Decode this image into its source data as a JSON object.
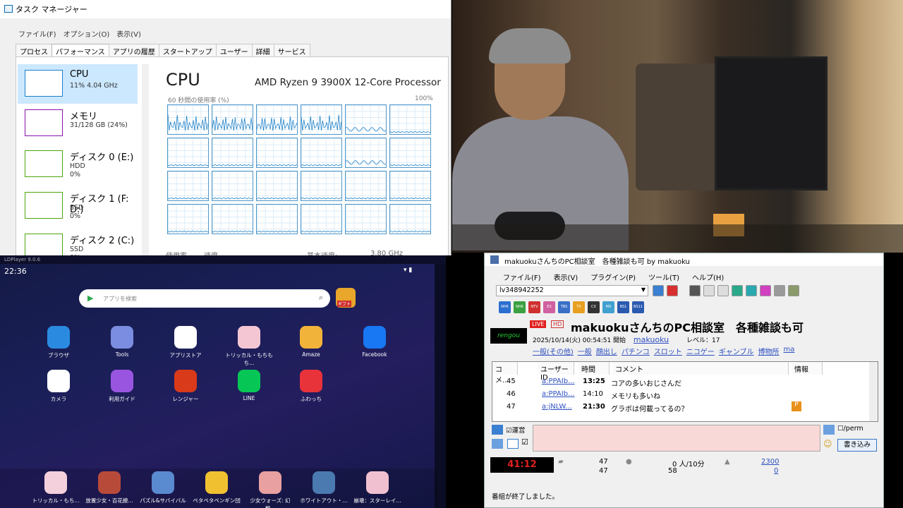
{
  "taskmgr": {
    "title": "タスク マネージャー",
    "menu": [
      "ファイル(F)",
      "オプション(O)",
      "表示(V)"
    ],
    "tabs": [
      "プロセス",
      "パフォーマンス",
      "アプリの履歴",
      "スタートアップ",
      "ユーザー",
      "詳細",
      "サービス"
    ],
    "sidebar": [
      {
        "title": "CPU",
        "l1": "11%  4.04 GHz",
        "l2": ""
      },
      {
        "title": "メモリ",
        "l1": "31/128 GB (24%)",
        "l2": ""
      },
      {
        "title": "ディスク 0 (E:)",
        "l1": "HDD",
        "l2": "0%"
      },
      {
        "title": "ディスク 1 (F: D:)",
        "l1": "SSD",
        "l2": "0%"
      },
      {
        "title": "ディスク 2 (C:)",
        "l1": "SSD",
        "l2": "0%"
      }
    ],
    "heading": "CPU",
    "processor": "AMD Ryzen 9 3900X 12-Core Processor",
    "axis_left": "60 秒間の使用率 (%)",
    "axis_right": "100%",
    "bottom_labels": [
      "使用率",
      "速度",
      "基本速度:",
      "3.80 GHz"
    ],
    "colors": {
      "accent": "#1b7fc8",
      "selected": "#cce8ff",
      "memory": "#8b12ae",
      "disk": "#4da60c"
    }
  },
  "emulator": {
    "topbar": "LDPlayer  9.0.6",
    "clock": "22:36",
    "search_placeholder": "アプリを検索",
    "gift_label": "ギフト",
    "apps": [
      {
        "label": "ブラウザ",
        "icon": "browser-icon",
        "color": "#2a8ae0"
      },
      {
        "label": "Tools",
        "icon": "tools-icon",
        "color": "#7b8de0"
      },
      {
        "label": "アプリストア",
        "icon": "gamepad-icon",
        "color": "#ffffff"
      },
      {
        "label": "トリッカル・もちもち...",
        "icon": "game-icon",
        "color": "#f4c6d4"
      },
      {
        "label": "Amaze",
        "icon": "folder-icon",
        "color": "#f2b33a"
      },
      {
        "label": "Facebook",
        "icon": "facebook-icon",
        "color": "#1877f2"
      },
      {
        "label": "カメラ",
        "icon": "camera-icon",
        "color": "#ffffff"
      },
      {
        "label": "利用ガイド",
        "icon": "guide-icon",
        "color": "#9a55e0"
      },
      {
        "label": "レンジャー",
        "icon": "ranger-icon",
        "color": "#d83a1a"
      },
      {
        "label": "LINE",
        "icon": "line-icon",
        "color": "#06c755"
      },
      {
        "label": "ふわっち",
        "icon": "fuwacchi-icon",
        "color": "#e8333a"
      }
    ],
    "dock": [
      {
        "label": "トリッカル・もち...",
        "color": "#f4d0dc"
      },
      {
        "label": "放置少女・百花繚...",
        "color": "#b84a3a"
      },
      {
        "label": "パズル&サバイバル",
        "color": "#5a8ad0"
      },
      {
        "label": "ペタペタペンギン団",
        "color": "#f0c030"
      },
      {
        "label": "少女ウォーズ: 幻想...",
        "color": "#e8a0a0"
      },
      {
        "label": "ホワイトアウト・...",
        "color": "#4a7ab0"
      },
      {
        "label": "崩壊：スターレイ...",
        "color": "#f0c0d0"
      }
    ]
  },
  "ncv": {
    "title": "makuokuさんちのPC相談室　各種雑談も可 by makuoku",
    "menu": [
      "ファイル(F)",
      "表示(V)",
      "プラグイン(P)",
      "ツール(T)",
      "ヘルプ(H)"
    ],
    "live_id": "lv348942252",
    "channels": [
      "NHK",
      "NHK",
      "NTV",
      "EX",
      "TBS",
      "TX",
      "CX",
      "MX",
      "BS1",
      "BS11"
    ],
    "channel_colors": [
      "#2c6fd0",
      "#3aa040",
      "#d03030",
      "#d060a0",
      "#3a70c8",
      "#e8a020",
      "#333333",
      "#40a0d0",
      "#2a5ab0",
      "#2a5ab0"
    ],
    "logo": "rengou",
    "live_badge": "LIVE",
    "hd_badge": "HD",
    "program_title": "makuokuさんちのPC相談室　各種雑談も可",
    "start_info": "2025/10/14(火) 00:54:51 開始",
    "owner": "makuoku",
    "level": "レベル：17",
    "tags": [
      "一般(その他)",
      "一般",
      "顔出し",
      "パチンコ",
      "スロット",
      "ニコゲー",
      "ギャンブル",
      "博物所",
      "ma"
    ],
    "columns": [
      "コメ...",
      "ユーザーID",
      "時間",
      "コメント",
      "情報"
    ],
    "comments": [
      {
        "no": "45",
        "user": "a:PPAIb...",
        "time": "13:25",
        "text": "コアの多いおじさんだ",
        "info": ""
      },
      {
        "no": "46",
        "user": "a:PPAIb...",
        "time": "14:10",
        "text": "メモリも多いね",
        "info": ""
      },
      {
        "no": "47",
        "user": "a:jNLW...",
        "time": "21:30",
        "text": "グラボは何載ってるの？",
        "info": "P"
      }
    ],
    "unei": "運営",
    "perm": "/perm",
    "post_button": "書き込み",
    "timer": "41:12",
    "stats": {
      "comments_a": "47",
      "comments_b": "47",
      "viewers": "0",
      "viewers_label": "人/10分",
      "visitors": "58",
      "ad": "2300",
      "gift": "0"
    },
    "status": "番組が終了しました。"
  }
}
